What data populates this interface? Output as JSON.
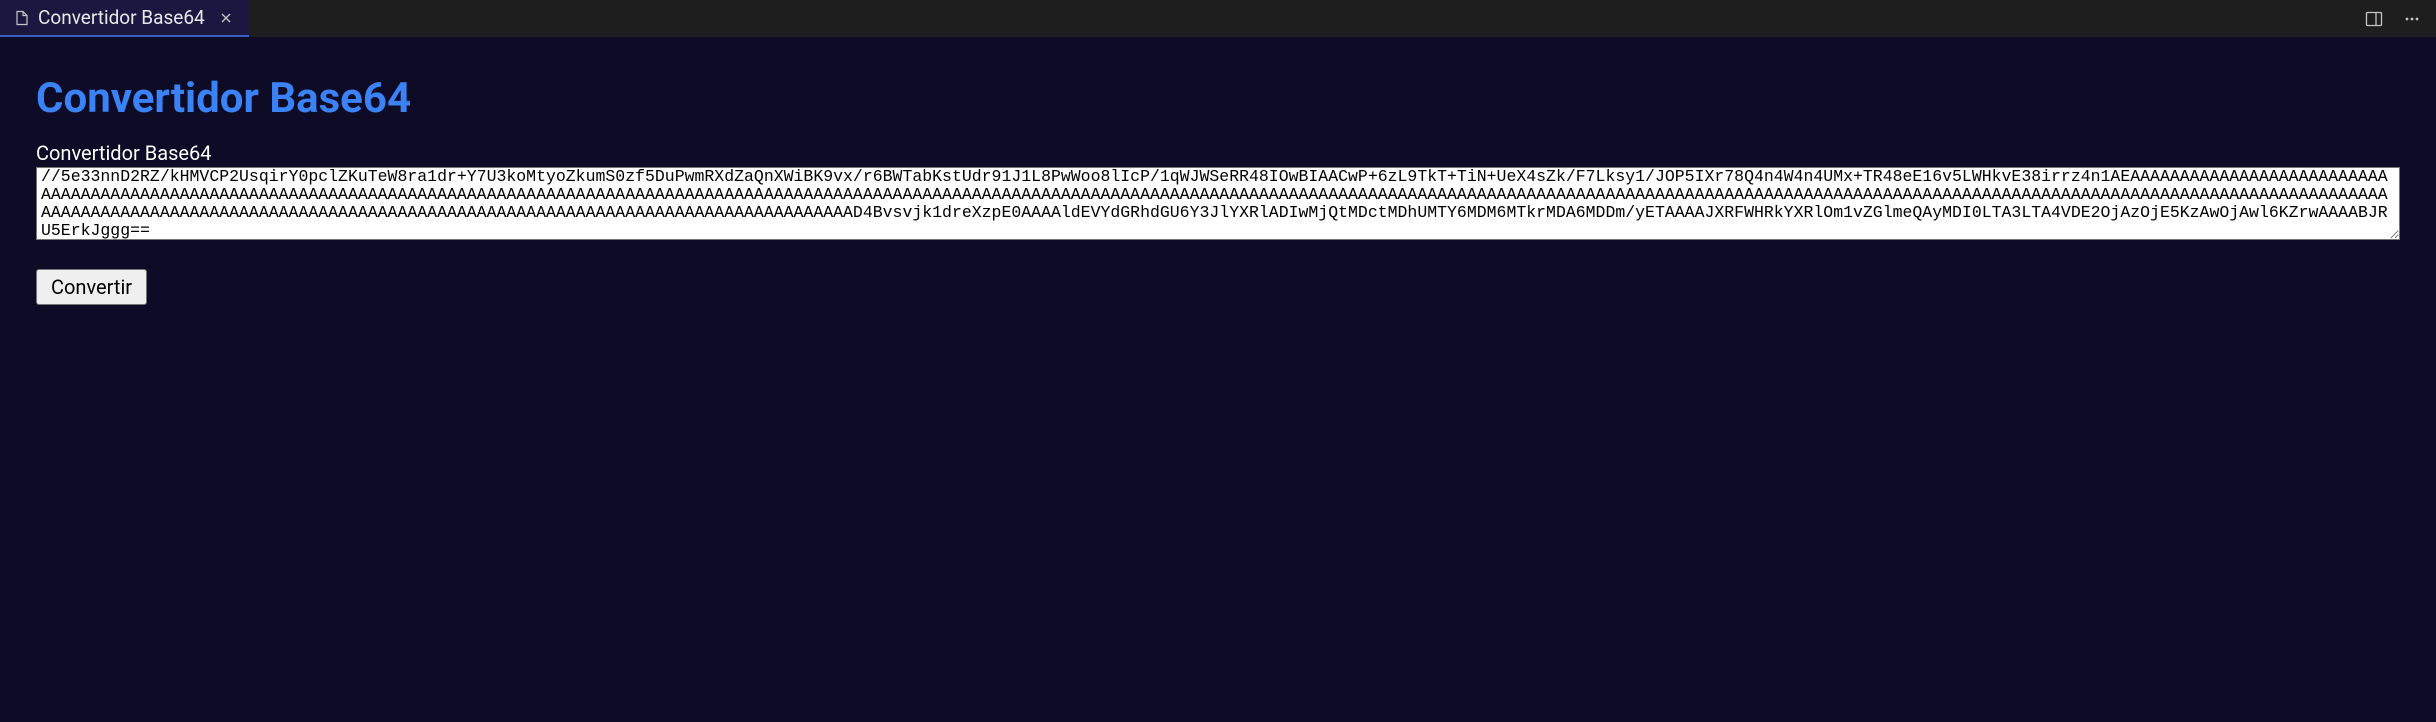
{
  "tab": {
    "title": "Convertidor Base64"
  },
  "page": {
    "title": "Convertidor Base64",
    "label": "Convertidor Base64",
    "textarea_value": "//5e33nnD2RZ/kHMVCP2UsqirY0pclZKuTeW8ra1dr+Y7U3koMtyoZkumS0zf5DuPwmRXdZaQnXWiBK9vx/r6BWTabKstUdr91J1L8PwWoo8lIcP/1qWJWSeRR48IOwBIAACwP+6zL9TkT+TiN+UeX4sZk/F7Lksy1/JOP5IXr78Q4n4W4n4UMx+TR48eE16v5LWHkvE38irrz4n1AEAAAAAAAAAAAAAAAAAAAAAAAAAAAAAAAAAAAAAAAAAAAAAAAAAAAAAAAAAAAAAAAAAAAAAAAAAAAAAAAAAAAAAAAAAAAAAAAAAAAAAAAAAAAAAAAAAAAAAAAAAAAAAAAAAAAAAAAAAAAAAAAAAAAAAAAAAAAAAAAAAAAAAAAAAAAAAAAAAAAAAAAAAAAAAAAAAAAAAAAAAAAAAAAAAAAAAAAAAAAAAAAAAAAAAAAAAAAAAAAAAAAAAAAAAAAAAAAAAAAAAAAAAAAAAAAAAAAAAAAAAAAAAAAAAAAAAAAAAAAAAAAAAAAAAAAAAAAAAAAAAAAAAAAAAAAAAAAAAAAAAAAAAD4Bvsvjk1dreXzpE0AAAAldEVYdGRhdGU6Y3JlYXRlADIwMjQtMDctMDhUMTY6MDM6MTkrMDA6MDDm/yETAAAAJXRFWHRkYXRlOm1vZGlmeQAyMDI0LTA3LTA4VDE2OjAzOjE5KzAwOjAwl6KZrwAAAABJRU5ErkJggg==",
    "button_label": "Convertir"
  }
}
